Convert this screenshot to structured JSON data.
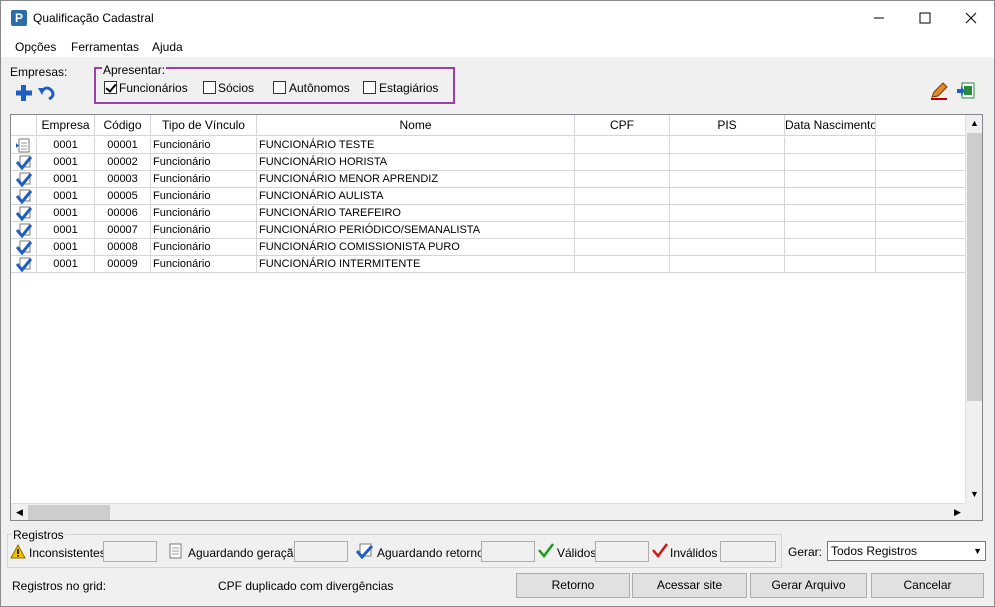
{
  "window": {
    "title": "Qualificação Cadastral",
    "app_icon_letter": "P",
    "controls": [
      "minimize-icon",
      "maximize-icon",
      "close-icon"
    ]
  },
  "menu": [
    {
      "label": "Opções"
    },
    {
      "label": "Ferramentas"
    },
    {
      "label": "Ajuda"
    }
  ],
  "toolbar": {
    "empresas_label": "Empresas:",
    "add_icon": "plus-icon",
    "undo_icon": "undo-icon",
    "edit_icon": "pencil-icon",
    "export_icon": "excel-export-icon"
  },
  "filter": {
    "legend": "Apresentar:",
    "options": [
      {
        "label": "Funcionários",
        "checked": true
      },
      {
        "label": "Sócios",
        "checked": false
      },
      {
        "label": "Autônomos",
        "checked": false
      },
      {
        "label": "Estagiários",
        "checked": false
      }
    ]
  },
  "grid": {
    "columns": [
      "",
      "Empresa",
      "Código",
      "Tipo de Vínculo",
      "Nome",
      "CPF",
      "PIS",
      "Data Nascimento"
    ],
    "rows": [
      {
        "status": "pending",
        "empresa": "0001",
        "codigo": "00001",
        "tipo": "Funcionário",
        "nome": "FUNCIONÁRIO TESTE",
        "cpf": "",
        "pis": "",
        "nascimento": ""
      },
      {
        "status": "waiting",
        "empresa": "0001",
        "codigo": "00002",
        "tipo": "Funcionário",
        "nome": "FUNCIONÁRIO HORISTA",
        "cpf": "",
        "pis": "",
        "nascimento": ""
      },
      {
        "status": "waiting",
        "empresa": "0001",
        "codigo": "00003",
        "tipo": "Funcionário",
        "nome": "FUNCIONÁRIO MENOR APRENDIZ",
        "cpf": "",
        "pis": "",
        "nascimento": ""
      },
      {
        "status": "waiting",
        "empresa": "0001",
        "codigo": "00005",
        "tipo": "Funcionário",
        "nome": "FUNCIONÁRIO AULISTA",
        "cpf": "",
        "pis": "",
        "nascimento": ""
      },
      {
        "status": "waiting",
        "empresa": "0001",
        "codigo": "00006",
        "tipo": "Funcionário",
        "nome": "FUNCIONÁRIO TAREFEIRO",
        "cpf": "",
        "pis": "",
        "nascimento": ""
      },
      {
        "status": "waiting",
        "empresa": "0001",
        "codigo": "00007",
        "tipo": "Funcionário",
        "nome": "FUNCIONÁRIO PERIÓDICO/SEMANALISTA",
        "cpf": "",
        "pis": "",
        "nascimento": ""
      },
      {
        "status": "waiting",
        "empresa": "0001",
        "codigo": "00008",
        "tipo": "Funcionário",
        "nome": "FUNCIONÁRIO COMISSIONISTA PURO",
        "cpf": "",
        "pis": "",
        "nascimento": ""
      },
      {
        "status": "waiting",
        "empresa": "0001",
        "codigo": "00009",
        "tipo": "Funcionário",
        "nome": "FUNCIONÁRIO INTERMITENTE",
        "cpf": "",
        "pis": "",
        "nascimento": ""
      }
    ]
  },
  "registros": {
    "legend": "Registros",
    "items": [
      {
        "icon": "warning-icon",
        "label": "Inconsistentes",
        "value": ""
      },
      {
        "icon": "document-icon",
        "label": "Aguardando geração",
        "value": ""
      },
      {
        "icon": "blue-check-icon",
        "label": "Aguardando retorno",
        "value": ""
      },
      {
        "icon": "green-check-icon",
        "label": "Válidos",
        "value": ""
      },
      {
        "icon": "red-check-icon",
        "label": "Inválidos",
        "value": ""
      }
    ],
    "gerar_label": "Gerar:",
    "gerar_value": "Todos Registros"
  },
  "footer": {
    "grid_count_label": "Registros no grid:",
    "cpf_dup_label": "CPF duplicado com divergências",
    "buttons": {
      "retorno": "Retorno",
      "acessar_site": "Acessar site",
      "gerar_arquivo": "Gerar Arquivo",
      "cancelar": "Cancelar"
    }
  },
  "colors": {
    "filter_border": "#9b3fa4",
    "accent_blue": "#1f5fbf",
    "check_green": "#1a9b1a",
    "check_red": "#d01818",
    "warning_yellow": "#f5c400"
  }
}
